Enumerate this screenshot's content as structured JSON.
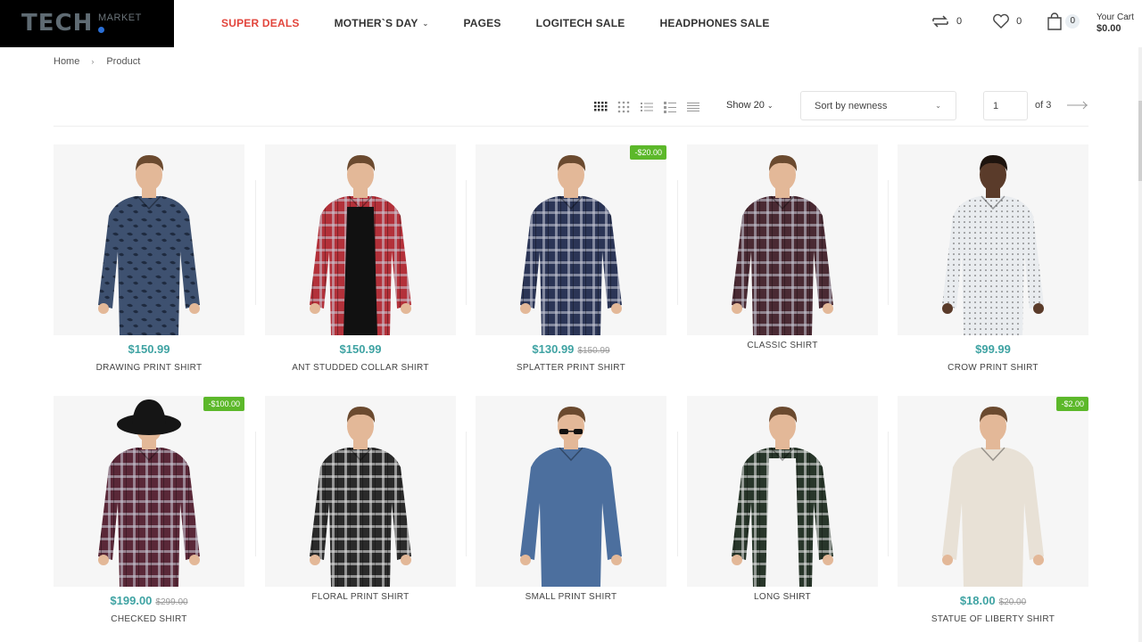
{
  "brand": {
    "name": "TECH",
    "sub": "MARKET"
  },
  "nav": [
    {
      "label": "SUPER DEALS"
    },
    {
      "label": "MOTHER`S DAY"
    },
    {
      "label": "PAGES"
    },
    {
      "label": "LOGITECH SALE"
    },
    {
      "label": "HEADPHONES SALE"
    }
  ],
  "header": {
    "compare_count": "0",
    "wishlist_count": "0",
    "cart_count": "0",
    "cart_label": "Your Cart",
    "cart_total": "$0.00"
  },
  "breadcrumb": {
    "home": "Home",
    "current": "Product"
  },
  "toolbar": {
    "show_label": "Show 20",
    "sort_label": "Sort by newness",
    "page_value": "1",
    "of_label": "of  3"
  },
  "products": [
    {
      "name": "DRAWING PRINT SHIRT",
      "price": "$150.99",
      "old_price": "",
      "badge": "",
      "shirt": "#3e5170",
      "pattern": "print"
    },
    {
      "name": "ANT STUDDED COLLAR SHIRT",
      "price": "$150.99",
      "old_price": "",
      "badge": "",
      "shirt": "#b3313a",
      "pattern": "plaid-open"
    },
    {
      "name": "SPLATTER PRINT SHIRT",
      "price": "$130.99",
      "old_price": "$150.99",
      "badge": "-$20.00",
      "shirt": "#2b3556",
      "pattern": "plaid"
    },
    {
      "name": "CLASSIC SHIRT",
      "price": "",
      "old_price": "",
      "badge": "",
      "shirt": "#4a2a33",
      "pattern": "plaid"
    },
    {
      "name": "CROW PRINT SHIRT",
      "price": "$99.99",
      "old_price": "",
      "badge": "",
      "shirt": "#e9ecef",
      "pattern": "dots"
    },
    {
      "name": "CHECKED SHIRT",
      "price": "$199.00",
      "old_price": "$299.00",
      "badge": "-$100.00",
      "shirt": "#5a2838",
      "pattern": "plaid"
    },
    {
      "name": "FLORAL PRINT SHIRT",
      "price": "",
      "old_price": "",
      "badge": "",
      "shirt": "#2a2a2a",
      "pattern": "plaid"
    },
    {
      "name": "SMALL PRINT SHIRT",
      "price": "",
      "old_price": "",
      "badge": "",
      "shirt": "#4c6f9e",
      "pattern": "plain"
    },
    {
      "name": "LONG SHIRT",
      "price": "",
      "old_price": "",
      "badge": "",
      "shirt": "#28362a",
      "pattern": "plaid-open"
    },
    {
      "name": "STATUE OF LIBERTY SHIRT",
      "price": "$18.00",
      "old_price": "$20.00",
      "badge": "-$2.00",
      "shirt": "#e8e1d6",
      "pattern": "plain"
    }
  ],
  "colors": {
    "accent": "#e2453c",
    "price": "#3fa3a3",
    "badge": "#5cb82a"
  },
  "icons": [
    "compare-icon",
    "heart-icon",
    "bag-icon",
    "grid-view-icon",
    "arrow-right-icon"
  ]
}
